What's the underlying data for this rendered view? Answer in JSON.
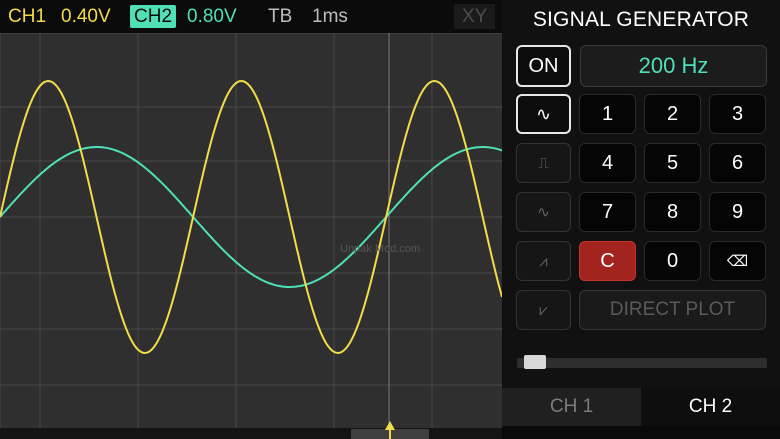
{
  "status_bar": {
    "ch1_label": "CH1",
    "ch1_volts": "0.40V",
    "ch2_label": "CH2",
    "ch2_volts": "0.80V",
    "tb_label": "TB",
    "tb_value": "1ms",
    "xy_label": "XY"
  },
  "colors": {
    "ch1": "#f2dc4a",
    "ch2": "#4fe0b6",
    "grid": "#494949",
    "background": "#2f2f2f",
    "clear_button": "#a3231f"
  },
  "waveforms": {
    "ch1": {
      "shape": "sine",
      "cycles_visible": 2.6,
      "amplitude_div": 2.5
    },
    "ch2": {
      "shape": "sine",
      "cycles_visible": 1.3,
      "amplitude_div": 1.3
    }
  },
  "watermark": "Unpak Mod.com",
  "generator": {
    "title": "SIGNAL GENERATOR",
    "on_label": "ON",
    "frequency": "200 Hz",
    "waveform_buttons": [
      {
        "icon": "sine-wave-icon",
        "glyph": "∿",
        "active": true
      },
      {
        "icon": "square-wave-icon",
        "glyph": "⎍",
        "active": false
      },
      {
        "icon": "triangle-wave-icon",
        "glyph": "∿",
        "active": false
      },
      {
        "icon": "sawtooth-wave-icon",
        "glyph": "⩘",
        "active": false
      },
      {
        "icon": "reverse-sawtooth-icon",
        "glyph": "⩗",
        "active": false
      }
    ],
    "keys": [
      "1",
      "2",
      "3",
      "4",
      "5",
      "6",
      "7",
      "8",
      "9",
      "C",
      "0"
    ],
    "backspace_icon": "backspace-icon",
    "backspace_glyph": "⌫",
    "direct_plot": "DIRECT PLOT",
    "level_fraction": 0.03,
    "tabs": {
      "ch1": "CH 1",
      "ch2": "CH 2"
    }
  }
}
